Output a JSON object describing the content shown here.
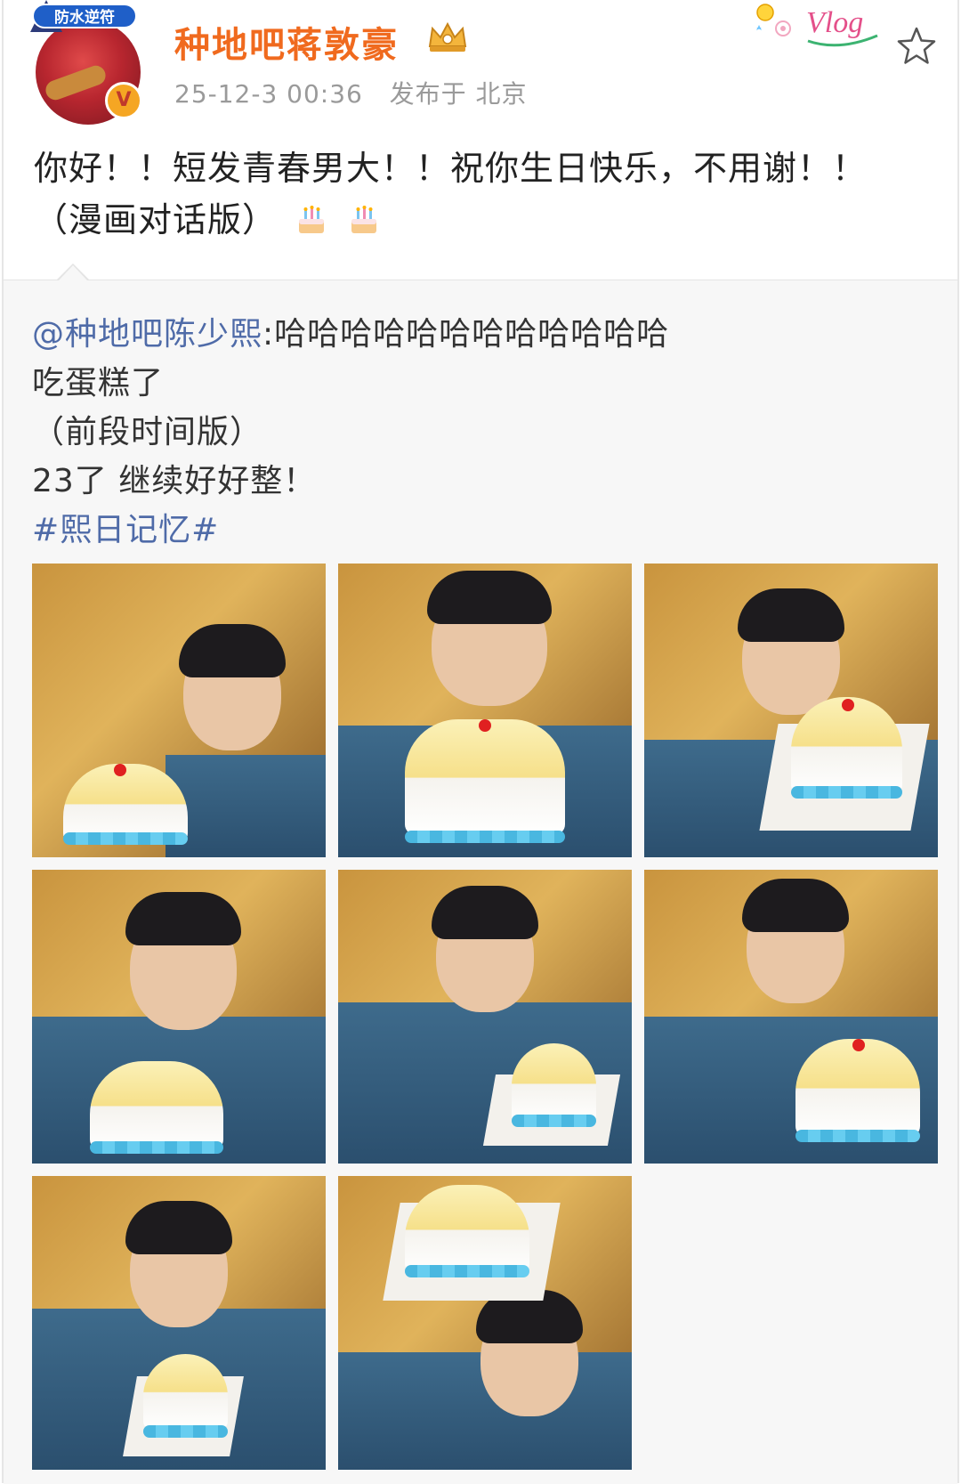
{
  "post": {
    "author": "种地吧蒋敦豪",
    "avatar_badge": "防水逆符",
    "verified_mark": "V",
    "timestamp": "25-12-3 00:36",
    "location_label": "发布于 北京",
    "content_line1": "你好！！短发青春男大！！祝你生日快乐，不用谢！！",
    "content_line2": "（漫画对话版）",
    "icons": [
      "crown-icon",
      "vlog-sticker",
      "star-icon",
      "cake-emoji"
    ]
  },
  "repost": {
    "mention": "@种地吧陈少熙",
    "line1_text": ":哈哈哈哈哈哈哈哈哈哈哈哈",
    "line2": "吃蛋糕了",
    "line3": "（前段时间版）",
    "line4": "23了 继续好好整！",
    "hashtag": "#熙日记忆#",
    "photo_count": 8
  },
  "colors": {
    "username": "#f06a1e",
    "link": "#4f6ba8",
    "meta": "#9a9a9a",
    "repost_bg": "#f7f7f7"
  }
}
